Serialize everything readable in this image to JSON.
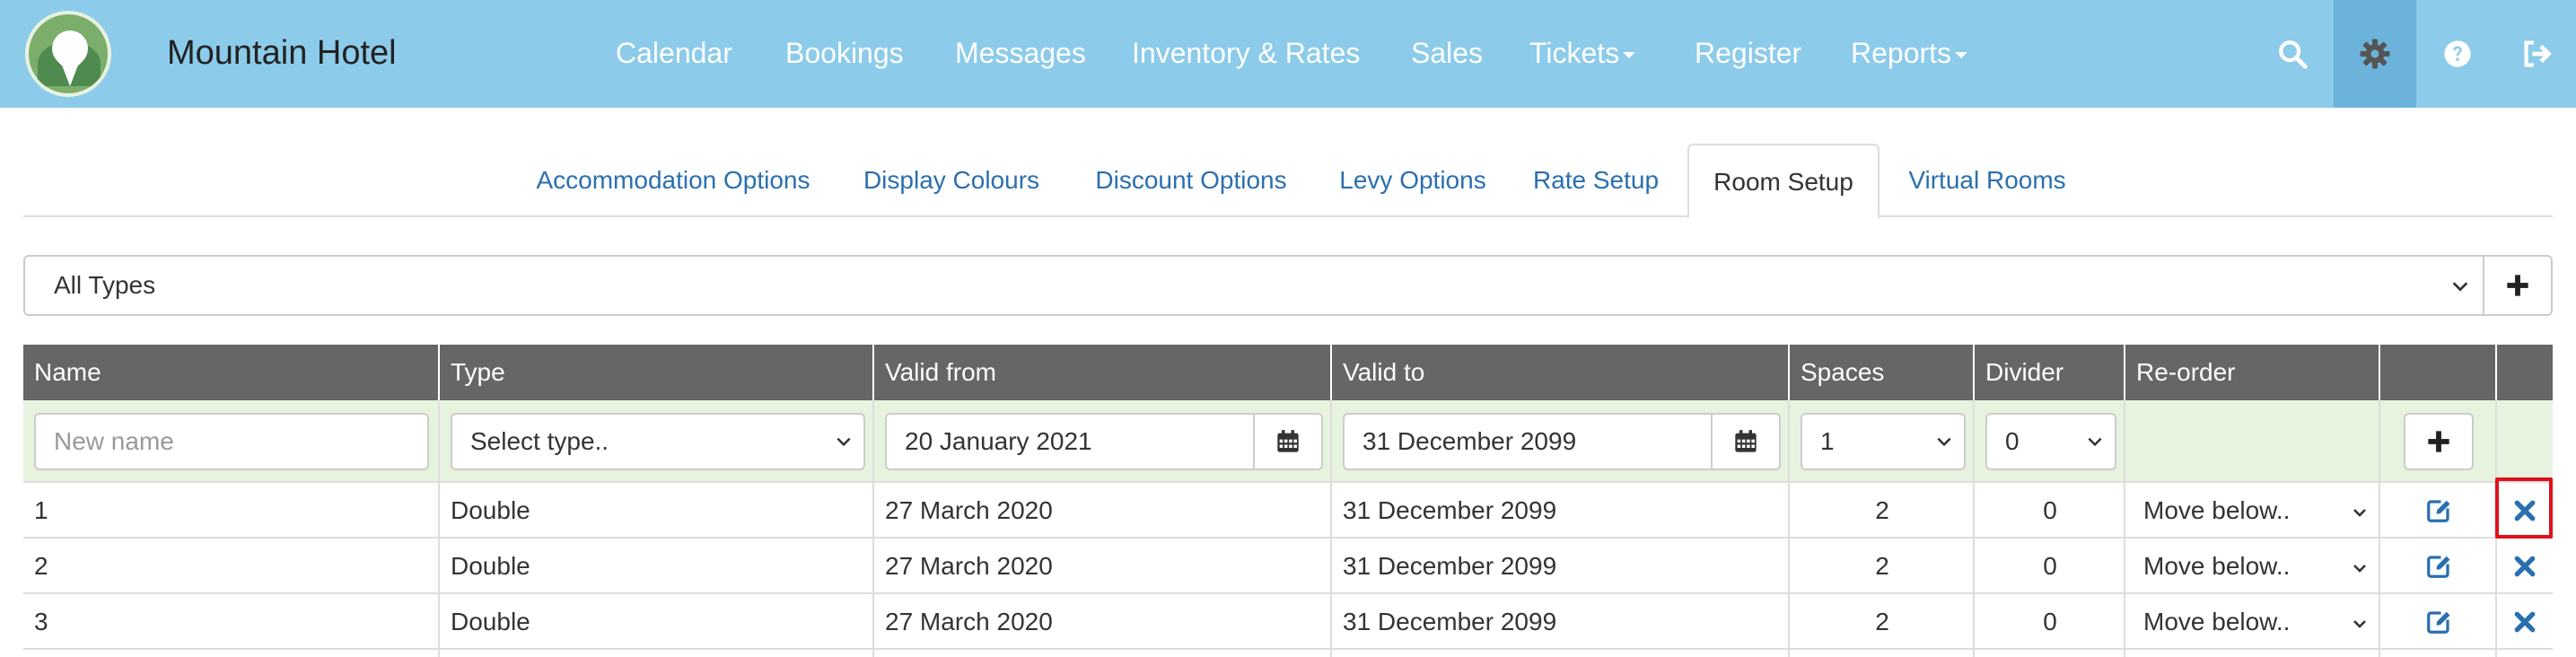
{
  "app": {
    "brand": "Mountain Hotel"
  },
  "nav": {
    "items": [
      {
        "label": "Calendar"
      },
      {
        "label": "Bookings"
      },
      {
        "label": "Messages"
      },
      {
        "label": "Inventory & Rates"
      },
      {
        "label": "Sales"
      },
      {
        "label": "Tickets"
      },
      {
        "label": "Register"
      },
      {
        "label": "Reports"
      }
    ],
    "icons": [
      "search-icon",
      "gear-icon",
      "help-icon",
      "logout-icon"
    ]
  },
  "tabs": [
    {
      "label": "Accommodation Options"
    },
    {
      "label": "Display Colours"
    },
    {
      "label": "Discount Options"
    },
    {
      "label": "Levy Options"
    },
    {
      "label": "Rate Setup"
    },
    {
      "label": "Room Setup",
      "active": true
    },
    {
      "label": "Virtual Rooms"
    }
  ],
  "filter": {
    "selected": "All Types"
  },
  "table": {
    "headers": {
      "name": "Name",
      "type": "Type",
      "valid_from": "Valid from",
      "valid_to": "Valid to",
      "spaces": "Spaces",
      "divider": "Divider",
      "reorder": "Re-order"
    },
    "new_row": {
      "name_placeholder": "New name",
      "type": "Select type..",
      "valid_from": "20 January 2021",
      "valid_to": "31 December 2099",
      "spaces": "1",
      "divider": "0"
    },
    "rows": [
      {
        "name": "1",
        "type": "Double",
        "valid_from": "27 March 2020",
        "valid_to": "31 December 2099",
        "spaces": "2",
        "divider": "0",
        "reorder": "Move below.."
      },
      {
        "name": "2",
        "type": "Double",
        "valid_from": "27 March 2020",
        "valid_to": "31 December 2099",
        "spaces": "2",
        "divider": "0",
        "reorder": "Move below.."
      },
      {
        "name": "3",
        "type": "Double",
        "valid_from": "27 March 2020",
        "valid_to": "31 December 2099",
        "spaces": "2",
        "divider": "0",
        "reorder": "Move below.."
      }
    ]
  },
  "colors": {
    "navbar": "#8ccbe9",
    "link": "#2a6fb0",
    "header": "#666666",
    "new_row": "#e6f3de",
    "highlight": "#e0101a"
  }
}
